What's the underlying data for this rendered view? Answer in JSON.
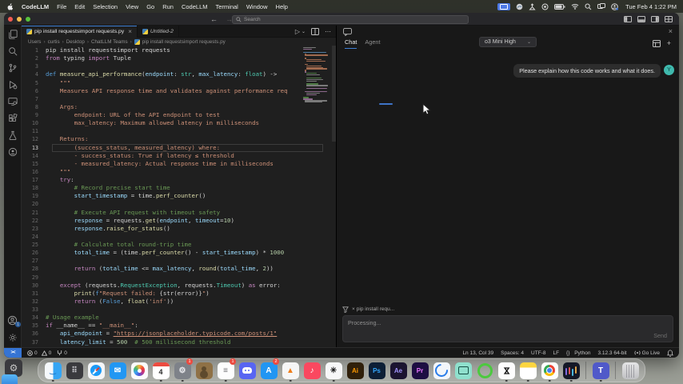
{
  "menu_bar": {
    "app_name": "CodeLLM",
    "items": [
      "File",
      "Edit",
      "Selection",
      "View",
      "Go",
      "Run",
      "CodeLLM",
      "Terminal",
      "Window",
      "Help"
    ],
    "clock": "Tue Feb 4 1:22 PM"
  },
  "title_bar": {
    "search_placeholder": "Search"
  },
  "tabs": [
    {
      "label": "pip install requestsimport requests.py",
      "close": "×"
    },
    {
      "label": "Untitled-2"
    }
  ],
  "tab_actions": {
    "run": "▷",
    "chevron": "⌄",
    "more": "⋯"
  },
  "breadcrumb": [
    "Users",
    "curtis",
    "Desktop",
    "ChatLLM Teams",
    "pip install requestsimport requests.py"
  ],
  "editor": {
    "current_line": 13,
    "lines": [
      {
        "n": 1,
        "s": [
          [
            "pip install requestsimport requests",
            "c"
          ]
        ]
      },
      {
        "n": 2,
        "s": [
          [
            "from",
            "kw"
          ],
          [
            " typing ",
            "c"
          ],
          [
            "import",
            "kw"
          ],
          [
            " Tuple",
            "c"
          ]
        ]
      },
      {
        "n": 3,
        "s": []
      },
      {
        "n": 4,
        "s": [
          [
            "def",
            "kb"
          ],
          [
            " ",
            "c"
          ],
          [
            "measure_api_performance",
            "fn"
          ],
          [
            "(",
            "c"
          ],
          [
            "endpoint",
            "vr"
          ],
          [
            ": ",
            "c"
          ],
          [
            "str",
            "ty"
          ],
          [
            ", ",
            "c"
          ],
          [
            "max_latency",
            "vr"
          ],
          [
            ": ",
            "c"
          ],
          [
            "float",
            "ty"
          ],
          [
            ") ->",
            "c"
          ]
        ]
      },
      {
        "n": 5,
        "s": [
          [
            "    \"\"\"",
            "st"
          ]
        ]
      },
      {
        "n": 6,
        "s": [
          [
            "    Measures API response time and validates against performance req",
            "st"
          ]
        ]
      },
      {
        "n": 7,
        "s": []
      },
      {
        "n": 8,
        "s": [
          [
            "    Args:",
            "st"
          ]
        ]
      },
      {
        "n": 9,
        "s": [
          [
            "        endpoint: URL of the API endpoint to test",
            "st"
          ]
        ]
      },
      {
        "n": 10,
        "s": [
          [
            "        max_latency: Maximum allowed latency in milliseconds",
            "st"
          ]
        ]
      },
      {
        "n": 11,
        "s": []
      },
      {
        "n": 12,
        "s": [
          [
            "    Returns:",
            "st"
          ]
        ]
      },
      {
        "n": 13,
        "s": [
          [
            "        (success_status, measured_latency) where:",
            "st"
          ]
        ]
      },
      {
        "n": 14,
        "s": [
          [
            "        - success_status: True if latency ≤ threshold",
            "st"
          ]
        ]
      },
      {
        "n": 15,
        "s": [
          [
            "        - measured_latency: Actual response time in milliseconds",
            "st"
          ]
        ]
      },
      {
        "n": 16,
        "s": [
          [
            "    \"\"\"",
            "st"
          ]
        ]
      },
      {
        "n": 17,
        "s": [
          [
            "    ",
            "c"
          ],
          [
            "try",
            "kw"
          ],
          [
            ":",
            "c"
          ]
        ]
      },
      {
        "n": 18,
        "s": [
          [
            "        ",
            "c"
          ],
          [
            "# Record precise start time",
            "cm"
          ]
        ]
      },
      {
        "n": 19,
        "s": [
          [
            "        ",
            "c"
          ],
          [
            "start_timestamp",
            "vr"
          ],
          [
            " = time.",
            "c"
          ],
          [
            "perf_counter",
            "fn"
          ],
          [
            "()",
            "c"
          ]
        ]
      },
      {
        "n": 20,
        "s": []
      },
      {
        "n": 21,
        "s": [
          [
            "        ",
            "c"
          ],
          [
            "# Execute API request with timeout safety",
            "cm"
          ]
        ]
      },
      {
        "n": 22,
        "s": [
          [
            "        ",
            "c"
          ],
          [
            "response",
            "vr"
          ],
          [
            " = requests.",
            "c"
          ],
          [
            "get",
            "fn"
          ],
          [
            "(",
            "c"
          ],
          [
            "endpoint",
            "vr"
          ],
          [
            ", ",
            "c"
          ],
          [
            "timeout",
            "vr"
          ],
          [
            "=",
            "c"
          ],
          [
            "10",
            "nm"
          ],
          [
            ")",
            "c"
          ]
        ]
      },
      {
        "n": 23,
        "s": [
          [
            "        ",
            "c"
          ],
          [
            "response",
            "vr"
          ],
          [
            ".",
            "c"
          ],
          [
            "raise_for_status",
            "fn"
          ],
          [
            "()",
            "c"
          ]
        ]
      },
      {
        "n": 24,
        "s": []
      },
      {
        "n": 25,
        "s": [
          [
            "        ",
            "c"
          ],
          [
            "# Calculate total round-trip time",
            "cm"
          ]
        ]
      },
      {
        "n": 26,
        "s": [
          [
            "        ",
            "c"
          ],
          [
            "total_time",
            "vr"
          ],
          [
            " = (time.",
            "c"
          ],
          [
            "perf_counter",
            "fn"
          ],
          [
            "() - ",
            "c"
          ],
          [
            "start_timestamp",
            "vr"
          ],
          [
            ") * ",
            "c"
          ],
          [
            "1000",
            "nm"
          ]
        ]
      },
      {
        "n": 27,
        "s": []
      },
      {
        "n": 28,
        "s": [
          [
            "        ",
            "c"
          ],
          [
            "return",
            "kw"
          ],
          [
            " (",
            "c"
          ],
          [
            "total_time",
            "vr"
          ],
          [
            " <= ",
            "c"
          ],
          [
            "max_latency",
            "vr"
          ],
          [
            ", ",
            "c"
          ],
          [
            "round",
            "fn"
          ],
          [
            "(",
            "c"
          ],
          [
            "total_time",
            "vr"
          ],
          [
            ", ",
            "c"
          ],
          [
            "2",
            "nm"
          ],
          [
            "))",
            "c"
          ]
        ]
      },
      {
        "n": 29,
        "s": []
      },
      {
        "n": 30,
        "s": [
          [
            "    ",
            "c"
          ],
          [
            "except",
            "kw"
          ],
          [
            " (requests.",
            "c"
          ],
          [
            "RequestException",
            "ty"
          ],
          [
            ", requests.",
            "c"
          ],
          [
            "Timeout",
            "ty"
          ],
          [
            ") ",
            "c"
          ],
          [
            "as",
            "kw"
          ],
          [
            " error:",
            "c"
          ]
        ]
      },
      {
        "n": 31,
        "s": [
          [
            "        ",
            "c"
          ],
          [
            "print",
            "fn"
          ],
          [
            "(",
            "c"
          ],
          [
            "f",
            "kb"
          ],
          [
            "\"Request failed: ",
            "st"
          ],
          [
            "{str(error)}",
            "c"
          ],
          [
            "\"",
            "st"
          ],
          [
            ")",
            "c"
          ]
        ]
      },
      {
        "n": 32,
        "s": [
          [
            "        ",
            "c"
          ],
          [
            "return",
            "kw"
          ],
          [
            " (",
            "c"
          ],
          [
            "False",
            "kb"
          ],
          [
            ", ",
            "c"
          ],
          [
            "float",
            "fn"
          ],
          [
            "(",
            "c"
          ],
          [
            "'inf'",
            "st"
          ],
          [
            "))",
            "c"
          ]
        ]
      },
      {
        "n": 33,
        "s": []
      },
      {
        "n": 34,
        "s": [
          [
            "# Usage example",
            "cm"
          ]
        ]
      },
      {
        "n": 35,
        "s": [
          [
            "if",
            "kw"
          ],
          [
            " __name__ == ",
            "c"
          ],
          [
            "\"__main__\"",
            "st"
          ],
          [
            ":",
            "c"
          ]
        ]
      },
      {
        "n": 36,
        "s": [
          [
            "    ",
            "c"
          ],
          [
            "api_endpoint",
            "vr"
          ],
          [
            " = ",
            "c"
          ],
          [
            "\"https://jsonplaceholder.typicode.com/posts/1\"",
            "su"
          ]
        ]
      },
      {
        "n": 37,
        "s": [
          [
            "    ",
            "c"
          ],
          [
            "latency_limit",
            "vr"
          ],
          [
            " = ",
            "c"
          ],
          [
            "500",
            "nm"
          ],
          [
            "  ",
            "c"
          ],
          [
            "# 500 millisecond threshold",
            "cm"
          ]
        ]
      }
    ]
  },
  "chat": {
    "tab_chat": "Chat",
    "tab_agent": "Agent",
    "model": "o3 Mini High",
    "chevron": "⌄",
    "close": "×",
    "plus": "+",
    "user_message": "Please explain how this code works and what it does.",
    "avatar_initial": "Y",
    "context_chip_close": "×",
    "context_chip": "pip install requ...",
    "input_text": "Processing...",
    "send_label": "Send"
  },
  "status_bar": {
    "remote": "><",
    "errors": "0",
    "warnings": "0",
    "forks": "0",
    "line_col": "Ln 13, Col 39",
    "spaces": "Spaces: 4",
    "encoding": "UTF-8",
    "eol": "LF",
    "braces": "{}",
    "language": "Python",
    "version": "3.12.3 64-bit",
    "go_live": "Go Live"
  },
  "nav": {
    "back": "←",
    "forward": "→"
  },
  "colors": {
    "accent": "#3f7fd4",
    "remote_blue": "#3574d4",
    "badge_red": "#ec4b40",
    "avatar_teal": "#3fb9ad"
  },
  "dock": {
    "apps": [
      {
        "id": "finder",
        "cls": "finder",
        "glyph": "‿",
        "bg": "",
        "fg": "#1b72c4",
        "running": true
      },
      {
        "id": "launchpad",
        "glyph": "⠿",
        "bg": "#3a3a3e",
        "fg": "#cfcfd4"
      },
      {
        "id": "safari",
        "cls": "safari",
        "glyph": "",
        "bg": "#f4f5f7"
      },
      {
        "id": "mail",
        "glyph": "✉",
        "bg": "#2197f3",
        "fg": "#ffffff"
      },
      {
        "id": "photos",
        "cls": "photos",
        "glyph": "",
        "bg": "#fbfbfb"
      },
      {
        "id": "calendar",
        "cls": "calendar",
        "glyph": "4",
        "bg": "#ffffff",
        "fg": "#2b2b2b",
        "running": true
      },
      {
        "id": "settings",
        "glyph": "⚙",
        "bg": "#7e8289",
        "fg": "#ececf0",
        "badge": "1",
        "running": true
      },
      {
        "id": "contacts",
        "cls": "contacts",
        "glyph": "",
        "bg": "#8f7146"
      },
      {
        "id": "reminders",
        "glyph": "≡",
        "bg": "#fdfdfd",
        "fg": "#6f6f73",
        "badge": "1",
        "running": true
      },
      {
        "id": "discord",
        "cls": "discord",
        "glyph": "",
        "bg": "#5865f2"
      },
      {
        "id": "appstore",
        "glyph": "A",
        "bg": "#2196f3",
        "fg": "#ffffff",
        "badge": "2"
      },
      {
        "id": "vlc",
        "glyph": "▲",
        "bg": "#f6f6f6",
        "fg": "#ef7d1a",
        "running": true
      },
      {
        "id": "music",
        "glyph": "♪",
        "bg": "#fa4860",
        "fg": "#ffffff"
      },
      {
        "id": "chatgpt",
        "glyph": "✳",
        "bg": "#f7f7f8",
        "fg": "#161616",
        "running": true
      },
      {
        "id": "illustrator",
        "glyph": "Ai",
        "two": true,
        "bg": "#30200b",
        "fg": "#ff9a00"
      },
      {
        "id": "photoshop",
        "glyph": "Ps",
        "two": true,
        "bg": "#0d1f36",
        "fg": "#34a8ff"
      },
      {
        "id": "aftereffects",
        "glyph": "Ae",
        "two": true,
        "bg": "#1b1430",
        "fg": "#a093fa"
      },
      {
        "id": "premiere",
        "glyph": "Pr",
        "two": true,
        "bg": "#1d0e42",
        "fg": "#ea77ff"
      },
      {
        "id": "comet-browser",
        "cls": "comet",
        "glyph": "",
        "bg": "#f3f6fa"
      },
      {
        "id": "screen-recorder",
        "cls": "recorder",
        "glyph": "",
        "bg": "#8fe0cd"
      },
      {
        "id": "green-ring-app",
        "cls": "greenring",
        "glyph": "",
        "bg": "transparent"
      },
      {
        "id": "capcut",
        "cls": "capcut",
        "glyph": "⋈",
        "bg": "#fdfdfd",
        "fg": "#111111",
        "running": true
      },
      {
        "id": "notes",
        "cls": "notes",
        "glyph": "",
        "bg": "",
        "running": true
      },
      {
        "id": "chrome",
        "cls": "chrome",
        "glyph": "",
        "bg": "#fdfdfd",
        "running": true
      },
      {
        "id": "chatllm",
        "cls": "llm",
        "glyph": "",
        "bg": "#141827",
        "running": true
      },
      {
        "type": "sep"
      },
      {
        "id": "teams",
        "glyph": "T",
        "bg": "#5059c9",
        "fg": "#ffffff",
        "running": true
      },
      {
        "type": "sep"
      },
      {
        "id": "trash",
        "cls": "trash",
        "glyph": "",
        "bg": ""
      }
    ]
  }
}
